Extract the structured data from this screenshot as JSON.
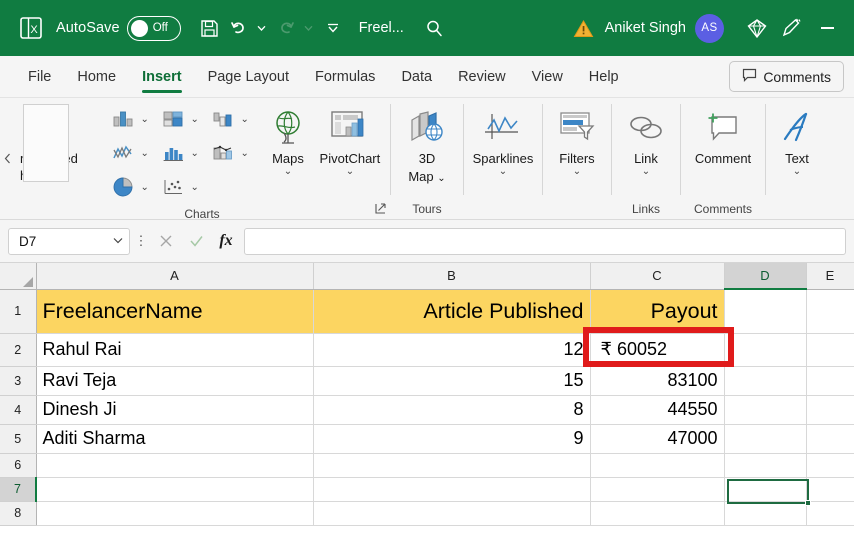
{
  "titlebar": {
    "app_icon": "excel-logo-icon",
    "autosave_label": "AutoSave",
    "autosave_state": "Off",
    "save_icon": "save-icon",
    "undo_icon": "undo-icon",
    "redo_icon": "redo-icon",
    "customize_qat_icon": "chevron-down-icon",
    "document_title": "Freel...",
    "search_icon": "search-icon",
    "warning_icon": "warning-triangle-icon",
    "user_name": "Aniket Singh",
    "user_initials": "AS",
    "diamond_icon": "diamond-icon",
    "pen_icon": "pen-icon",
    "minimize_label": "Minimize",
    "bg_color": "#107C41"
  },
  "tabs": [
    {
      "label": "File",
      "active": false
    },
    {
      "label": "Home",
      "active": false
    },
    {
      "label": "Insert",
      "active": true
    },
    {
      "label": "Page Layout",
      "active": false
    },
    {
      "label": "Formulas",
      "active": false
    },
    {
      "label": "Data",
      "active": false
    },
    {
      "label": "Review",
      "active": false
    },
    {
      "label": "View",
      "active": false
    },
    {
      "label": "Help",
      "active": false
    }
  ],
  "comments_button": {
    "label": "Comments",
    "icon": "comment-bubble-icon"
  },
  "ribbon": {
    "scroll_left_icon": "chevron-left-icon",
    "recommended_charts": {
      "label_line1": "mmended",
      "label_line2": "harts",
      "icon": "recommended-charts-icon"
    },
    "chart_small_buttons": [
      {
        "icon": "column-chart-icon",
        "caret": "chevron-down-icon"
      },
      {
        "icon": "line-chart-icon",
        "caret": "chevron-down-icon"
      },
      {
        "icon": "pie-chart-icon",
        "caret": "chevron-down-icon"
      },
      {
        "icon": "bar-chart-icon",
        "caret": "chevron-down-icon"
      },
      {
        "icon": "area-chart-icon",
        "caret": "chevron-down-icon"
      },
      {
        "icon": "scatter-chart-icon",
        "caret": "chevron-down-icon"
      },
      {
        "icon": "hierarchy-chart-icon",
        "caret": "chevron-down-icon"
      },
      {
        "icon": "waterfall-chart-icon",
        "caret": "chevron-down-icon"
      }
    ],
    "maps": {
      "label": "Maps",
      "caret": "chevron-down-icon",
      "icon": "globe-map-icon"
    },
    "pivotchart": {
      "label": "PivotChart",
      "caret": "chevron-down-icon",
      "icon": "pivotchart-icon"
    },
    "charts_group_label": "Charts",
    "charts_dialog_launcher": "dialog-launcher-icon",
    "map3d": {
      "label_line1": "3D",
      "label_line2": "Map",
      "caret": "chevron-down-icon",
      "icon": "3d-map-icon"
    },
    "tours_group_label": "Tours",
    "sparklines": {
      "label": "Sparklines",
      "caret": "chevron-down-icon",
      "icon": "sparklines-icon"
    },
    "filters": {
      "label": "Filters",
      "caret": "chevron-down-icon",
      "icon": "filter-icon"
    },
    "link": {
      "label": "Link",
      "caret": "chevron-down-icon",
      "icon": "link-icon"
    },
    "links_group_label": "Links",
    "comment": {
      "label": "Comment",
      "icon": "add-comment-icon"
    },
    "comments_group_label": "Comments",
    "text": {
      "label": "Text",
      "caret": "chevron-down-icon",
      "icon": "text-art-icon"
    }
  },
  "formula_bar": {
    "name_box_value": "D7",
    "name_box_caret": "chevron-down-icon",
    "more_icon": "vertical-dots-icon",
    "cancel_icon": "cancel-x-icon",
    "enter_icon": "confirm-check-icon",
    "function_icon": "fx-icon",
    "formula_value": "",
    "formula_placeholder": ""
  },
  "sheet": {
    "column_headers": [
      "A",
      "B",
      "C",
      "D",
      "E"
    ],
    "selected_column": "D",
    "selected_row": 7,
    "selected_cell": "D7",
    "row_numbers": [
      1,
      2,
      3,
      4,
      5,
      6,
      7,
      8
    ],
    "header_fill": "#FCD561",
    "rows": [
      {
        "num": 1,
        "header": true,
        "a": "FreelancerName",
        "b": "Article Published",
        "c": "Payout",
        "d": "",
        "e": ""
      },
      {
        "num": 2,
        "header": false,
        "a": "Rahul Rai",
        "b": "12",
        "c": "₹ 60052",
        "d": "",
        "e": ""
      },
      {
        "num": 3,
        "header": false,
        "a": "Ravi Teja",
        "b": "15",
        "c": "83100",
        "d": "",
        "e": ""
      },
      {
        "num": 4,
        "header": false,
        "a": "Dinesh Ji",
        "b": "8",
        "c": "44550",
        "d": "",
        "e": ""
      },
      {
        "num": 5,
        "header": false,
        "a": "Aditi Sharma",
        "b": "9",
        "c": "47000",
        "d": "",
        "e": ""
      },
      {
        "num": 6,
        "header": false,
        "a": "",
        "b": "",
        "c": "",
        "d": "",
        "e": ""
      },
      {
        "num": 7,
        "header": false,
        "a": "",
        "b": "",
        "c": "",
        "d": "",
        "e": ""
      },
      {
        "num": 8,
        "header": false,
        "a": "",
        "b": "",
        "c": "",
        "d": "",
        "e": ""
      }
    ],
    "annotation": {
      "target_cell": "C2",
      "color": "#E01B1B",
      "shape": "rectangle-highlight"
    }
  }
}
